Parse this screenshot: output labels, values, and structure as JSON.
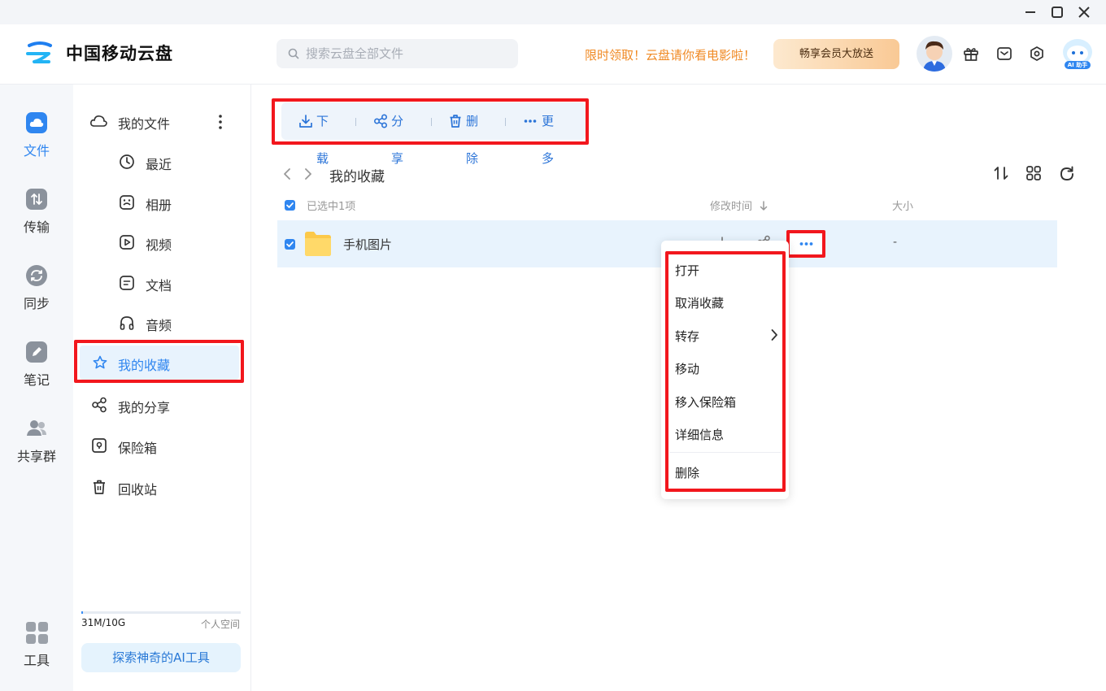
{
  "app": {
    "name": "中国移动云盘"
  },
  "header": {
    "search_placeholder": "搜索云盘全部文件",
    "promo_text": "限时领取！云盘请你看电影啦！",
    "vip_button": "畅享会员大放送",
    "ai_badge": "AI 助手"
  },
  "rail": {
    "items": [
      {
        "label": "文件",
        "icon": "cloud-icon",
        "active": true
      },
      {
        "label": "传输",
        "icon": "transfer-icon"
      },
      {
        "label": "同步",
        "icon": "sync-icon"
      },
      {
        "label": "笔记",
        "icon": "pencil-icon"
      },
      {
        "label": "共享群",
        "icon": "group-icon"
      },
      {
        "label": "工具",
        "icon": "grid-icon"
      }
    ]
  },
  "sidebar": {
    "my_files": "我的文件",
    "sub_items": [
      "最近",
      "相册",
      "视频",
      "文档",
      "音频"
    ],
    "favorites": "我的收藏",
    "shares": "我的分享",
    "safe": "保险箱",
    "recycle": "回收站",
    "storage_used": "31M/10G",
    "storage_fraction": 0.003,
    "storage_label": "个人空间",
    "ai_tools_button": "探索神奇的AI工具"
  },
  "toolbar": {
    "download": "下载",
    "share": "分享",
    "delete": "删除",
    "more": "更多"
  },
  "breadcrumb": {
    "current": "我的收藏"
  },
  "list": {
    "selected_text": "已选中1项",
    "col_modified": "修改时间",
    "col_size": "大小",
    "rows": [
      {
        "name": "手机图片",
        "size": "-",
        "type": "folder",
        "selected": true
      }
    ]
  },
  "context_menu": {
    "items": [
      "打开",
      "取消收藏",
      "转存",
      "移动",
      "移入保险箱",
      "详细信息",
      "删除"
    ]
  },
  "colors": {
    "accent": "#2f86f0",
    "highlight": "#f2171d",
    "promo": "#f08a24"
  }
}
